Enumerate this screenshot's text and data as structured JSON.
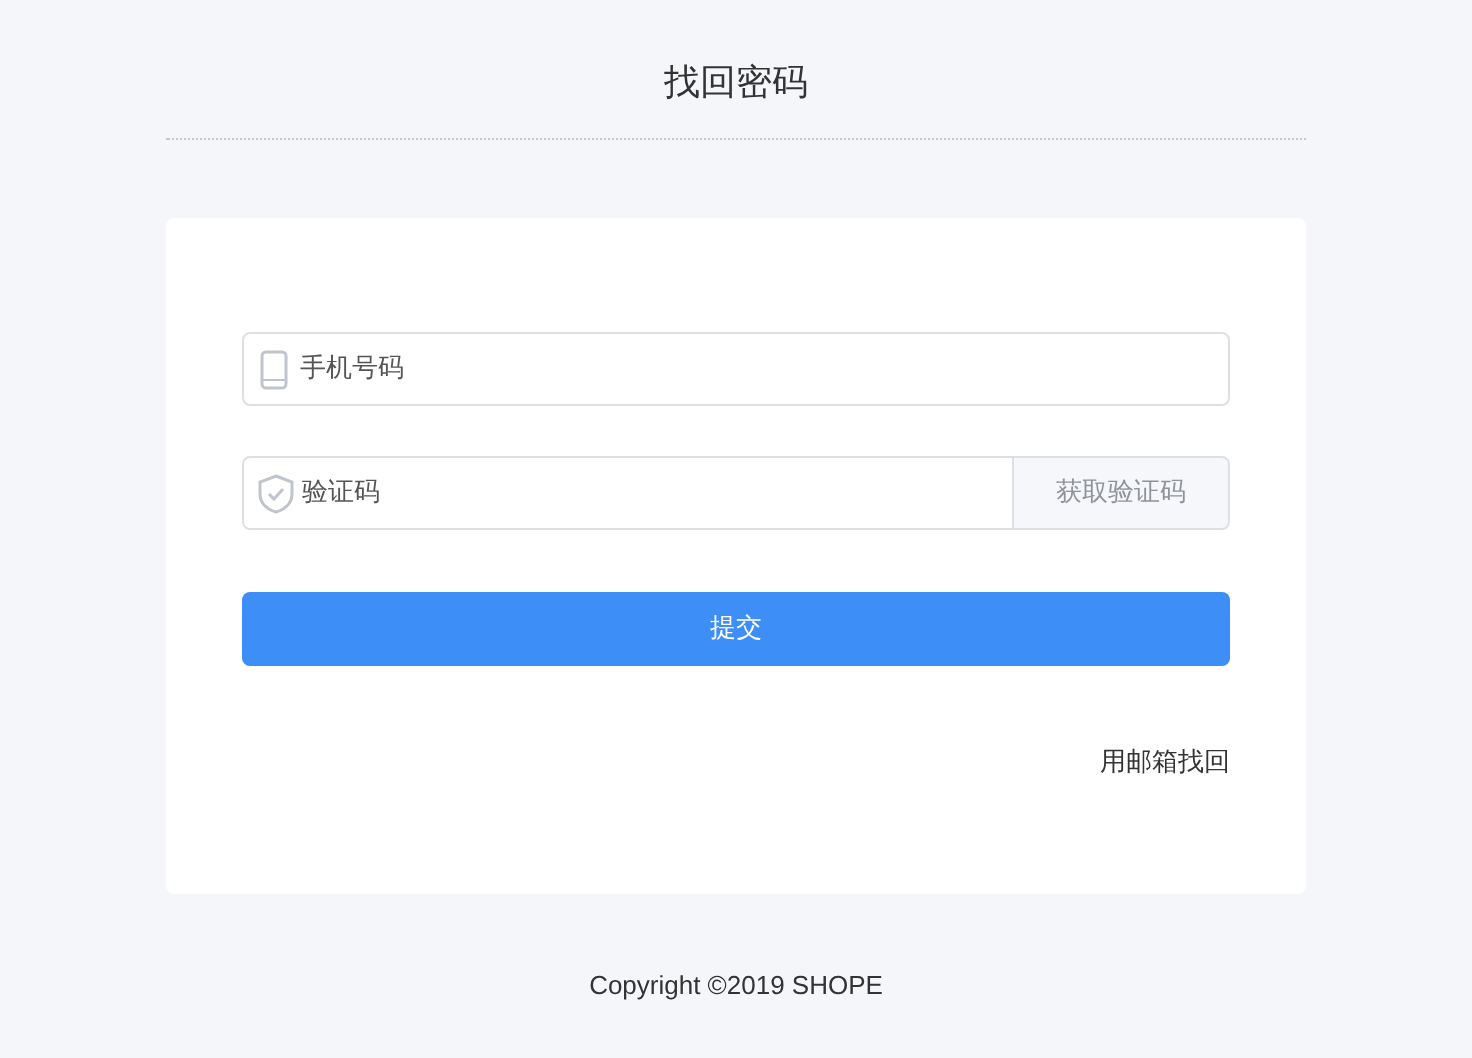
{
  "title": "找回密码",
  "phone_field": {
    "placeholder": "手机号码"
  },
  "code_field": {
    "placeholder": "验证码"
  },
  "get_code_button": "获取验证码",
  "submit_button": "提交",
  "email_link": "用邮箱找回",
  "footer": "Copyright ©2019 SHOPE"
}
